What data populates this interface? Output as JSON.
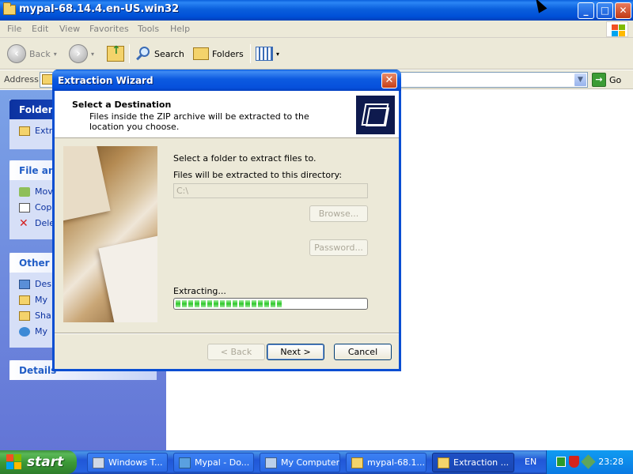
{
  "window": {
    "title": "mypal-68.14.4.en-US.win32",
    "icon": "folder-icon"
  },
  "menu": [
    "File",
    "Edit",
    "View",
    "Favorites",
    "Tools",
    "Help"
  ],
  "toolbar": {
    "back_label": "Back",
    "search_label": "Search",
    "folders_label": "Folders"
  },
  "address": {
    "label": "Address",
    "value": "",
    "go_label": "Go"
  },
  "taskpane": {
    "folder_tasks": {
      "title": "Folder T",
      "items": [
        "Extr"
      ]
    },
    "file_tasks": {
      "title": "File and",
      "items": [
        "Mov",
        "Cop",
        "Dele"
      ]
    },
    "other_places": {
      "title": "Other P",
      "items": [
        "Des",
        "My",
        "Sha",
        "My"
      ]
    },
    "details": {
      "title": "Details"
    }
  },
  "dialog": {
    "title": "Extraction Wizard",
    "header_title": "Select a Destination",
    "header_subtitle": "Files inside the ZIP archive will be extracted to the location you choose.",
    "instruction": "Select a folder to extract files to.",
    "directory_label": "Files will be extracted to this directory:",
    "directory_value": "C:\\",
    "browse_label": "Browse...",
    "password_label": "Password...",
    "progress_label": "Extracting...",
    "progress_fraction": 0.57,
    "back_label": "< Back",
    "next_label": "Next >",
    "cancel_label": "Cancel"
  },
  "taskbar": {
    "start_label": "start",
    "tasks": [
      "Windows T...",
      "Mypal - Do...",
      "My Computer",
      "mypal-68.1...",
      "Extraction ..."
    ],
    "language": "EN",
    "clock": "23:28"
  },
  "colors": {
    "titlebar_blue": "#0a5fdc",
    "taskpane_blue": "#7ba2e7",
    "progress_green": "#2ec72b",
    "start_green": "#3c9a37"
  }
}
